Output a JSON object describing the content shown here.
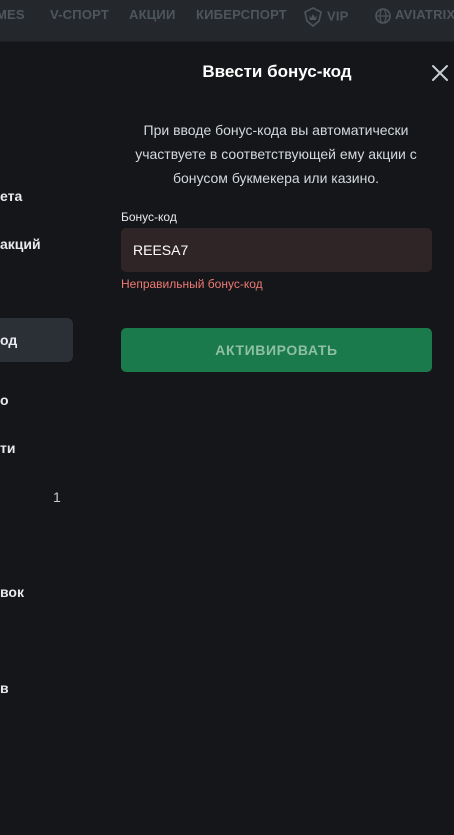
{
  "topnav": {
    "items": [
      "MES",
      "V-СПОРТ",
      "АКЦИИ",
      "КИБЕРСПОРТ",
      "VIP",
      "AVIATRIX"
    ],
    "icons": {
      "vip": "crown-shield-icon",
      "aviatrix": "globe-icon"
    }
  },
  "sidebar": {
    "items": [
      "ета",
      "акций",
      "од",
      "о",
      "ти",
      "вок",
      "в"
    ],
    "badge": "1",
    "active_index": 2
  },
  "modal": {
    "title": "Ввести бонус-код",
    "description": "При вводе бонус-кода вы автоматически участвуете в соответствующей ему акции с бонусом букмекера или казино.",
    "field_label": "Бонус-код",
    "field_value": "REESA7",
    "error": "Неправильный бонус-код",
    "activate_label": "АКТИВИРОВАТЬ",
    "close_icon": "close-icon"
  },
  "colors": {
    "background": "#141619",
    "accent_green": "#1b7a4b",
    "error_red": "#f07a74",
    "input_bg": "#2f2527"
  }
}
